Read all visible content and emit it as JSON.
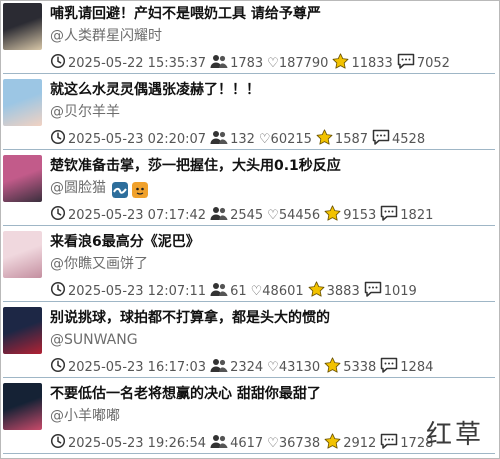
{
  "posts": [
    {
      "title": "哺乳请回避！产妇不是喂奶工具 请给予尊严",
      "author": "@人类群星闪耀时",
      "time": "2025-05-22 15:35:37",
      "users": "1783",
      "likes": "♡187790",
      "stars": "11833",
      "comments": "7052",
      "thumb_colors": [
        "#2b2b33",
        "#d8c7a8"
      ]
    },
    {
      "title": "就这么水灵灵偶遇张凌赫了！！！",
      "author": "@贝尔羊羊",
      "time": "2025-05-23 02:20:07",
      "users": "132",
      "likes": "♡60215",
      "stars": "1587",
      "comments": "4528",
      "thumb_colors": [
        "#9cc6e4",
        "#f2d2c2"
      ]
    },
    {
      "title": "楚钦准备击掌，莎一把握住，大头用0.1秒反应",
      "author": "@圆脸猫",
      "author_badges": [
        "wave",
        "tiger"
      ],
      "time": "2025-05-23 07:17:42",
      "users": "2545",
      "likes": "♡54456",
      "stars": "9153",
      "comments": "1821",
      "thumb_colors": [
        "#c25b8a",
        "#3a2f3d"
      ]
    },
    {
      "title": "来看浪6最高分《泥巴》",
      "author": "@你瞧又画饼了",
      "time": "2025-05-23 12:07:11",
      "users": "61",
      "likes": "♡48601",
      "stars": "3883",
      "comments": "1019",
      "thumb_colors": [
        "#f0d8de",
        "#c48fa0"
      ]
    },
    {
      "title": "别说挑球，球拍都不打算拿，都是头大的惯的",
      "author": "@SUNWANG",
      "time": "2025-05-23 16:17:03",
      "users": "2324",
      "likes": "♡43130",
      "stars": "5338",
      "comments": "1284",
      "thumb_colors": [
        "#1d2745",
        "#b22234"
      ]
    },
    {
      "title": "不要低估一名老将想赢的决心 甜甜你最甜了",
      "author": "@小羊嘟嘟",
      "time": "2025-05-23 19:26:54",
      "users": "4617",
      "likes": "♡36738",
      "stars": "2912",
      "comments": "1728",
      "thumb_colors": [
        "#152235",
        "#c94a6a"
      ]
    }
  ],
  "watermark": "红草",
  "colors": {
    "star": "#f2c200",
    "icon": "#333333",
    "divider": "#9fb6c6"
  }
}
